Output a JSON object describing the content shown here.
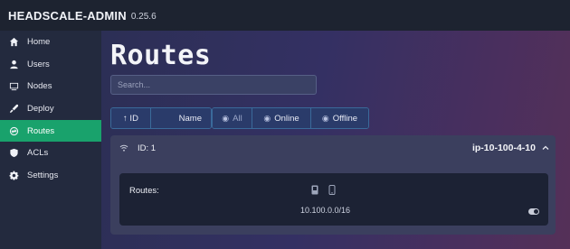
{
  "app": {
    "name": "HEADSCALE-ADMIN",
    "version": "0.25.6"
  },
  "sidebar": {
    "items": [
      {
        "label": "Home",
        "icon": "home-icon",
        "active": false
      },
      {
        "label": "Users",
        "icon": "user-icon",
        "active": false
      },
      {
        "label": "Nodes",
        "icon": "nodes-icon",
        "active": false
      },
      {
        "label": "Deploy",
        "icon": "deploy-icon",
        "active": false
      },
      {
        "label": "Routes",
        "icon": "routes-icon",
        "active": true
      },
      {
        "label": "ACLs",
        "icon": "shield-icon",
        "active": false
      },
      {
        "label": "Settings",
        "icon": "gear-icon",
        "active": false
      }
    ]
  },
  "page": {
    "title": "Routes"
  },
  "search": {
    "placeholder": "Search...",
    "value": ""
  },
  "sort": {
    "id_label": "↑ ID",
    "name_label": "Name"
  },
  "filters": {
    "all_label": "All",
    "online_label": "Online",
    "offline_label": "Offline"
  },
  "route_card": {
    "id_label": "ID: 1",
    "hostname": "ip-10-100-4-10",
    "routes_label": "Routes:",
    "routes": [
      {
        "cidr": "10.100.0.0/16",
        "enabled": true
      }
    ]
  },
  "colors": {
    "accent": "#19a26c",
    "topbar": "#1d2330",
    "sidebar": "#232a3e"
  }
}
